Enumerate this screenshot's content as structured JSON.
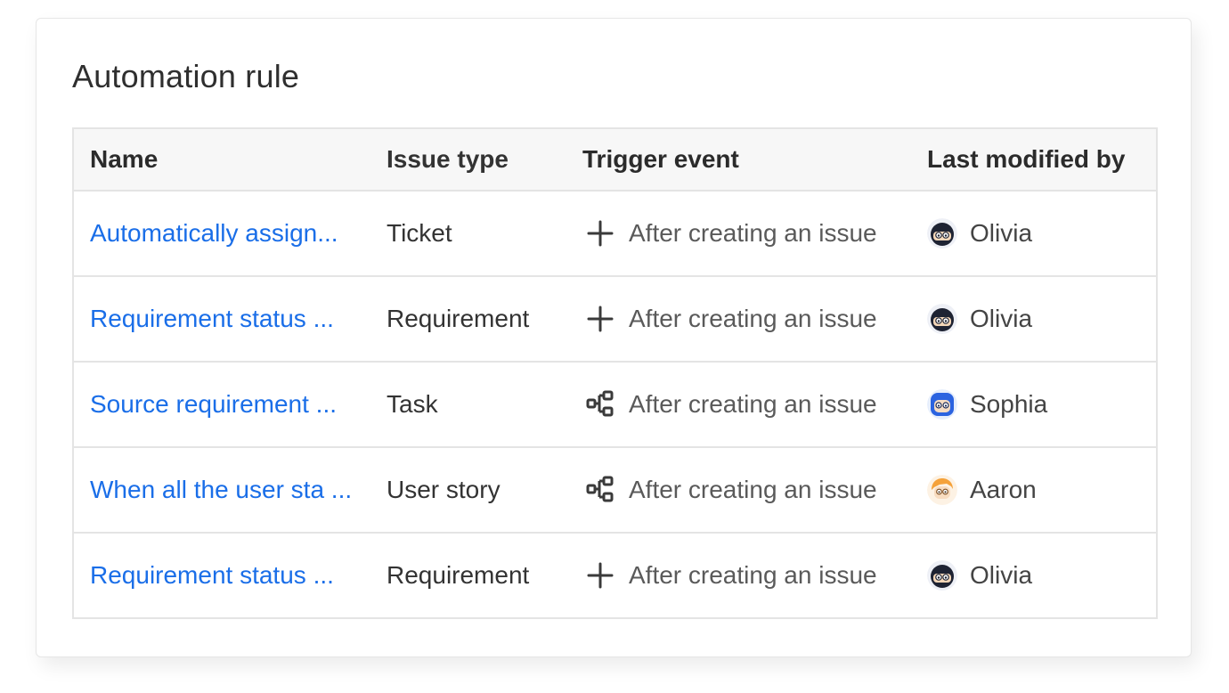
{
  "title": "Automation rule",
  "columns": {
    "name": "Name",
    "issue_type": "Issue type",
    "trigger": "Trigger event",
    "modified_by": "Last modified by"
  },
  "rows": [
    {
      "name": "Automatically assign...",
      "issue_type": "Ticket",
      "trigger_icon": "plus-icon",
      "trigger": "After creating an issue",
      "user": "Olivia",
      "avatar": "avatar-olivia"
    },
    {
      "name": "Requirement status ...",
      "issue_type": "Requirement",
      "trigger_icon": "plus-icon",
      "trigger": "After creating an issue",
      "user": "Olivia",
      "avatar": "avatar-olivia"
    },
    {
      "name": "Source requirement ...",
      "issue_type": "Task",
      "trigger_icon": "workflow-icon",
      "trigger": "After creating an issue",
      "user": "Sophia",
      "avatar": "avatar-sophia"
    },
    {
      "name": "When all the user sta ...",
      "issue_type": "User story",
      "trigger_icon": "workflow-icon",
      "trigger": "After creating an issue",
      "user": "Aaron",
      "avatar": "avatar-aaron"
    },
    {
      "name": "Requirement status ...",
      "issue_type": "Requirement",
      "trigger_icon": "plus-icon",
      "trigger": "After creating an issue",
      "user": "Olivia",
      "avatar": "avatar-olivia"
    }
  ],
  "colors": {
    "link": "#1a6ee8",
    "header_bg": "#f7f7f7",
    "border": "#e4e4e4"
  }
}
